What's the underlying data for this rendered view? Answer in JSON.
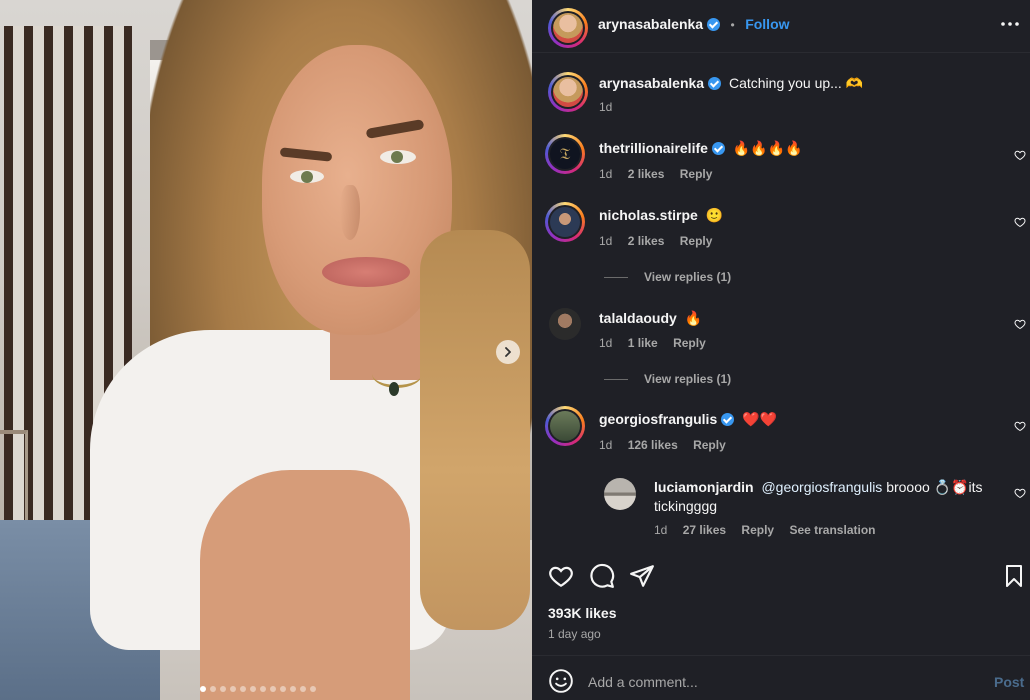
{
  "post": {
    "author": "arynasabalenka",
    "follow_label": "Follow",
    "dot_separator": "•",
    "more_icon": "more-icon",
    "caption": "Catching you up... 🫶",
    "caption_time": "1d",
    "carousel": {
      "count": 12,
      "active_index": 0
    }
  },
  "comments": [
    {
      "user": "thetrillionairelife",
      "verified": true,
      "text": "🔥🔥🔥🔥",
      "time": "1d",
      "likes": "2 likes",
      "reply": "Reply",
      "avatar_text": "𝔗"
    },
    {
      "user": "nicholas.stirpe",
      "verified": false,
      "text": "🙂",
      "time": "1d",
      "likes": "2 likes",
      "reply": "Reply",
      "view_replies": "View replies (1)"
    },
    {
      "user": "talaldaoudy",
      "verified": false,
      "text": "🔥",
      "time": "1d",
      "likes": "1 like",
      "reply": "Reply",
      "view_replies": "View replies (1)"
    },
    {
      "user": "georgiosfrangulis",
      "verified": true,
      "text": "❤️❤️",
      "time": "1d",
      "likes": "126 likes",
      "reply": "Reply"
    }
  ],
  "reply": {
    "user": "luciamonjardin",
    "mention": "@georgiosfrangulis",
    "text": " broooo 💍⏰its tickingggg",
    "time": "1d",
    "likes": "27 likes",
    "reply": "Reply",
    "translate": "See translation"
  },
  "stats": {
    "likes": "393K likes",
    "time": "1 day ago"
  },
  "composer": {
    "placeholder": "Add a comment...",
    "post_label": "Post"
  },
  "colors": {
    "panel_bg": "#1f2026",
    "accent": "#3897f0",
    "link": "#e0f1ff"
  }
}
